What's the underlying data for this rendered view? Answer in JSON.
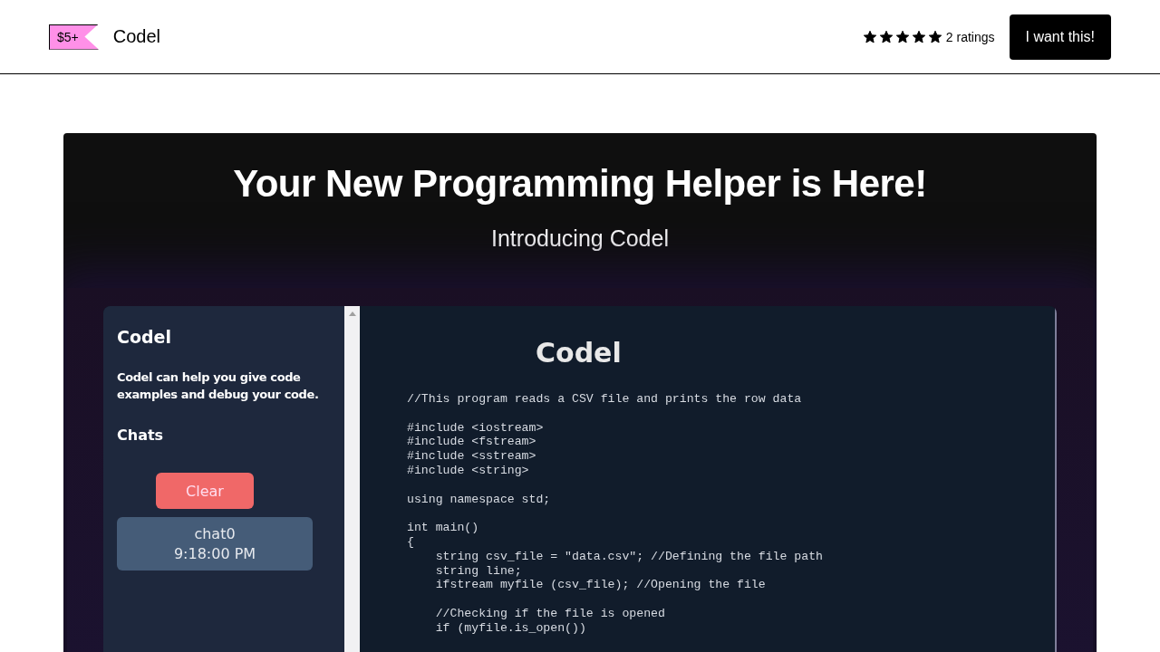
{
  "header": {
    "price": "$5+",
    "product_name": "Codel",
    "rating": {
      "stars": 5,
      "count": "2 ratings"
    },
    "buy_button": "I want this!"
  },
  "cover": {
    "headline": "Your New Programming Helper is Here!",
    "subheadline": "Introducing Codel",
    "app": {
      "sidebar": {
        "title": "Codel",
        "description": "Codel can help you give code examples and debug your code.",
        "chats_heading": "Chats",
        "clear_button": "Clear",
        "chats": [
          {
            "name": "chat0",
            "time": "9:18:00 PM"
          }
        ]
      },
      "main": {
        "title": "Codel",
        "code_blocks": [
          [
            "//This program reads a CSV file and prints the row data"
          ],
          [
            "#include <iostream>",
            "#include <fstream>",
            "#include <sstream>",
            "#include <string>"
          ],
          [
            "using namespace std;"
          ],
          [
            "int main()",
            "{",
            "    string csv_file = \"data.csv\"; //Defining the file path",
            "    string line;",
            "    ifstream myfile (csv_file); //Opening the file"
          ],
          [
            "    //Checking if the file is opened",
            "    if (myfile.is_open())"
          ]
        ]
      }
    }
  }
}
